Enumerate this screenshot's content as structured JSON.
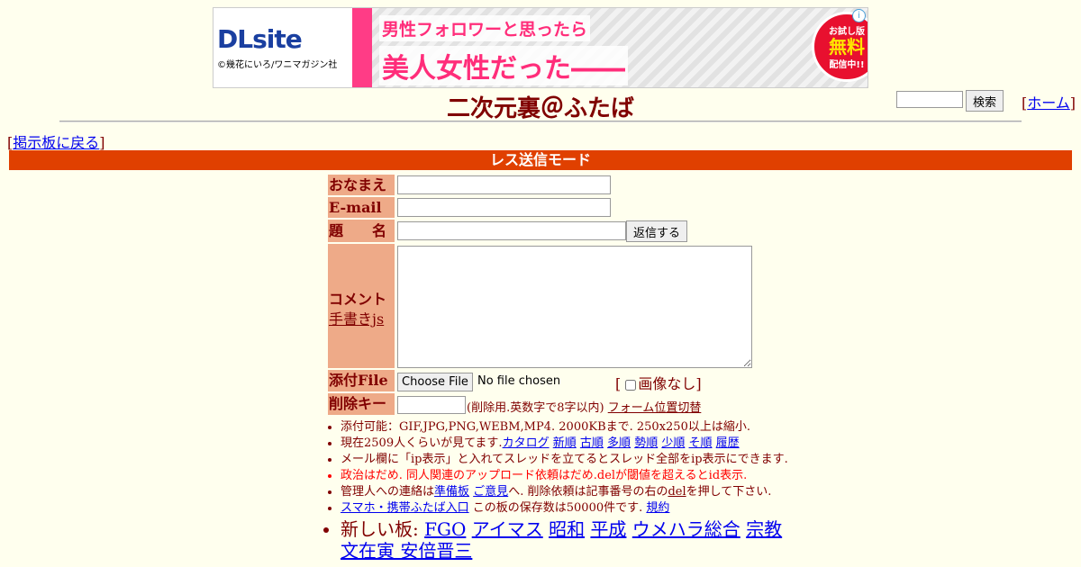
{
  "banner": {
    "brand": "DLsite",
    "copyright": "©幾花にいろ/ワニマガジン社",
    "headline": "男性フォロワーと思ったら",
    "subhead": "美人女性だった――",
    "badge_top": "お試し版",
    "badge_main": "無料",
    "badge_bottom": "配信中!!",
    "info": "i"
  },
  "header": {
    "title": "二次元裏＠ふたば",
    "search_button": "検索",
    "home_link": "ホーム",
    "back_link": "掲示板に戻る"
  },
  "mode_bar": "レス送信モード",
  "form": {
    "name_label": "おなまえ",
    "email_label": "E-mail",
    "subject_label": "題　　名",
    "reply_button": "返信する",
    "comment_label": "コメント",
    "handwrite_link": "手書きjs",
    "file_label": "添付File",
    "choose_file_button": "Choose File",
    "no_file_text": "No file chosen",
    "no_image_label": "画像なし",
    "delete_key_label": "削除キー",
    "delete_key_note": "(削除用.英数字で8字以内)",
    "form_position_link": "フォーム位置切替"
  },
  "rules": {
    "r1": "添付可能：GIF,JPG,PNG,WEBM,MP4. 2000KBまで. 250x250以上は縮小.",
    "r2_prefix": "現在2509人くらいが見てます.",
    "r2_links": [
      "カタログ",
      "新順",
      "古順",
      "多順",
      "勢順",
      "少順",
      "そ順",
      "履歴"
    ],
    "r3": "メール欄に「ip表示」と入れてスレッドを立てるとスレッド全部をip表示にできます.",
    "r4": "政治はだめ. 同人関連のアップロード依頼はだめ.delが閾値を超えるとid表示.",
    "r5_a": "管理人への連絡は",
    "r5_link1": "準備板",
    "r5_link2": "ご意見",
    "r5_b": "へ. 削除依頼は記事番号の右の",
    "r5_link3": "del",
    "r5_c": "を押して下さい.",
    "r6_link": "スマホ・携帯ふたば入口",
    "r6_text": "この板の保存数は50000件です.",
    "r6_link2": "規約",
    "r7_label": "新しい板:",
    "r7_links": [
      "FGO",
      "アイマス",
      "昭和",
      "平成",
      "ウメハラ総合",
      "宗教"
    ],
    "r7_line2": "文在寅 安倍晋三"
  }
}
